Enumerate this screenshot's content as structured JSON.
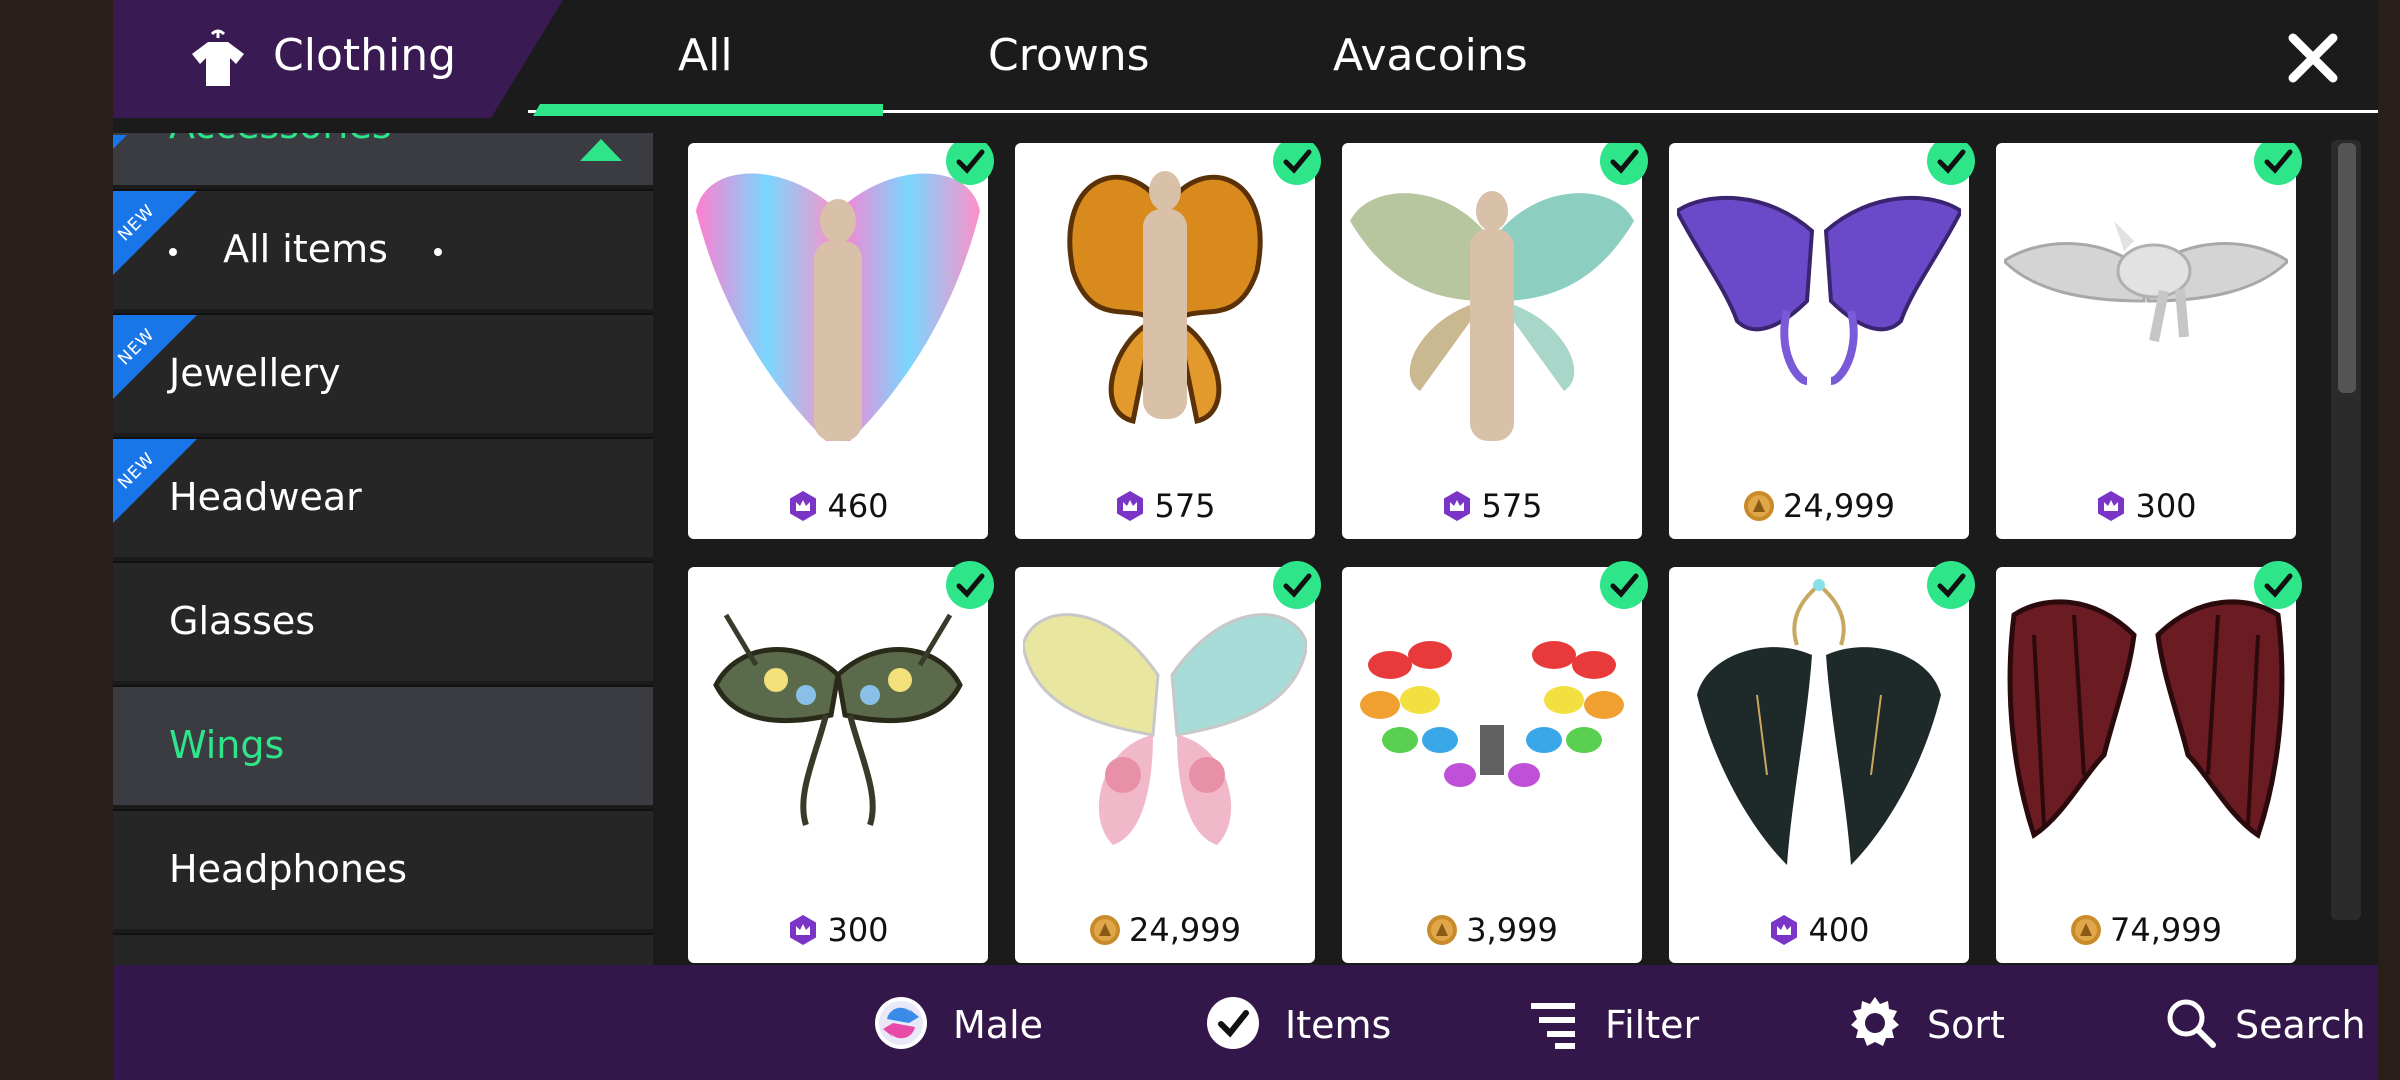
{
  "header": {
    "category_title": "Clothing",
    "tabs": [
      "All",
      "Crowns",
      "Avacoins"
    ],
    "active_tab": "All"
  },
  "sidebar": {
    "items": [
      {
        "label": "Accessories",
        "new": false,
        "active": true
      },
      {
        "label": "All items",
        "new": true,
        "active": false
      },
      {
        "label": "Jewellery",
        "new": true,
        "active": false
      },
      {
        "label": "Headwear",
        "new": true,
        "active": false
      },
      {
        "label": "Glasses",
        "new": false,
        "active": false
      },
      {
        "label": "Wings",
        "new": false,
        "active": true
      },
      {
        "label": "Headphones",
        "new": false,
        "active": false
      }
    ],
    "new_badge": "NEW"
  },
  "items": [
    {
      "price": "460",
      "currency": "crown",
      "owned": true,
      "art": "pink-feather-wings"
    },
    {
      "price": "575",
      "currency": "crown",
      "owned": true,
      "art": "orange-butterfly-wings"
    },
    {
      "price": "575",
      "currency": "crown",
      "owned": true,
      "art": "teal-feather-wings"
    },
    {
      "price": "24,999",
      "currency": "avacoin",
      "owned": true,
      "art": "purple-fairy-wings"
    },
    {
      "price": "300",
      "currency": "crown",
      "owned": true,
      "art": "white-pegasus-wings"
    },
    {
      "price": "300",
      "currency": "crown",
      "owned": true,
      "art": "floral-branch-wings"
    },
    {
      "price": "24,999",
      "currency": "avacoin",
      "owned": true,
      "art": "rose-butterfly-wings"
    },
    {
      "price": "3,999",
      "currency": "avacoin",
      "owned": true,
      "art": "rainbow-balloon-wings"
    },
    {
      "price": "400",
      "currency": "crown",
      "owned": true,
      "art": "black-gold-wings"
    },
    {
      "price": "74,999",
      "currency": "avacoin",
      "owned": true,
      "art": "red-dragon-wings"
    }
  ],
  "bottom_bar": {
    "male_label": "Male",
    "items_label": "Items",
    "filter_label": "Filter",
    "sort_label": "Sort",
    "search_label": "Search"
  },
  "colors": {
    "accent_green": "#2ee58a",
    "header_purple": "#3a1a52",
    "bottom_purple": "#34174a",
    "new_blue": "#1876e8",
    "crown_purple": "#7a35c6",
    "avacoin_gold": "#c98b2a"
  }
}
